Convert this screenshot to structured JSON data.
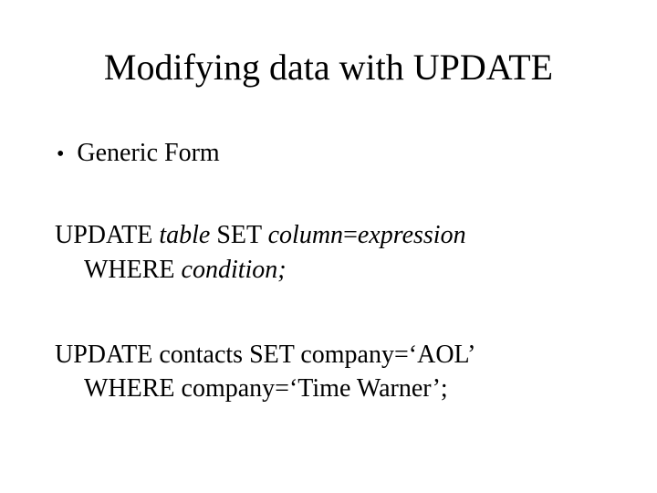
{
  "slide": {
    "title": "Modifying data with UPDATE",
    "bullet": "Generic Form",
    "generic": {
      "line1_pre": "UPDATE ",
      "line1_tbl": "table",
      "line1_mid": " SET ",
      "line1_col": "column",
      "line1_eq": "=",
      "line1_expr": "expression",
      "line2_where": "WHERE ",
      "line2_cond": "condition;"
    },
    "example": {
      "line1": "UPDATE contacts SET company=‘AOL’",
      "line2": "WHERE company=‘Time Warner’;"
    }
  }
}
